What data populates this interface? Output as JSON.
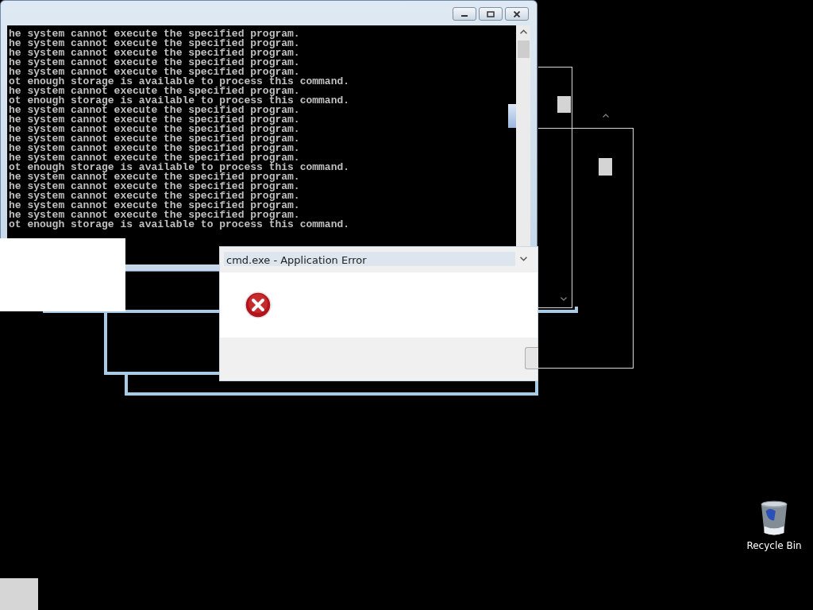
{
  "console": {
    "lines": [
      "he system cannot execute the specified program.",
      "he system cannot execute the specified program.",
      "he system cannot execute the specified program.",
      "he system cannot execute the specified program.",
      "he system cannot execute the specified program.",
      "ot enough storage is available to process this command.",
      "he system cannot execute the specified program.",
      "ot enough storage is available to process this command.",
      "he system cannot execute the specified program.",
      "he system cannot execute the specified program.",
      "he system cannot execute the specified program.",
      "he system cannot execute the specified program.",
      "he system cannot execute the specified program.",
      "he system cannot execute the specified program.",
      "ot enough storage is available to process this command.",
      "he system cannot execute the specified program.",
      "he system cannot execute the specified program.",
      "he system cannot execute the specified program.",
      "he system cannot execute the specified program.",
      "he system cannot execute the specified program.",
      "ot enough storage is available to process this command."
    ]
  },
  "dialog": {
    "title": "cmd.exe - Application Error"
  },
  "desktop_icons": [
    {
      "label": "Recycle Bin"
    }
  ]
}
